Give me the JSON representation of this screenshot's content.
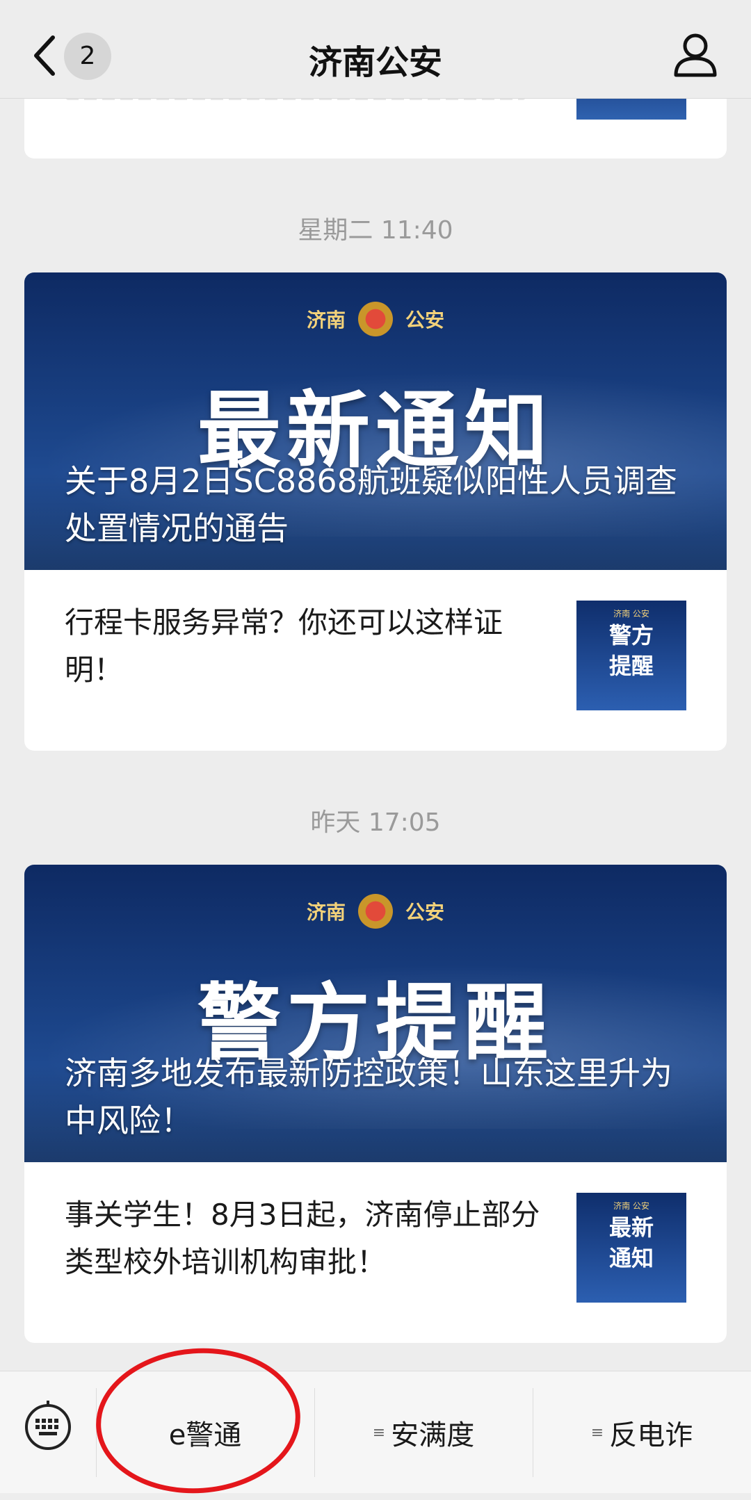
{
  "header": {
    "title": "济南公安",
    "unread_count": "2",
    "back_icon": "chevron-left-icon",
    "profile_icon": "person-icon"
  },
  "feed": {
    "groups": [
      {
        "timestamp": "星期二 11:40",
        "main": {
          "brand_left": "济南",
          "brand_right": "公安",
          "headline": "最新通知",
          "title": "关于8月2日SC8868航班疑似阳性人员调查处置情况的通告"
        },
        "items": [
          {
            "text": "行程卡服务异常？你还可以这样证明！",
            "thumb_brand": "济南 公安",
            "thumb_headline_line1": "警方",
            "thumb_headline_line2": "提醒"
          }
        ]
      },
      {
        "timestamp": "昨天 17:05",
        "main": {
          "brand_left": "济南",
          "brand_right": "公安",
          "headline": "警方提醒",
          "title": "济南多地发布最新防控政策！山东这里升为中风险！"
        },
        "items": [
          {
            "text": "事关学生！8月3日起，济南停止部分类型校外培训机构审批！",
            "thumb_brand": "济南 公安",
            "thumb_headline_line1": "最新",
            "thumb_headline_line2": "通知"
          }
        ]
      }
    ]
  },
  "bottom_bar": {
    "keyboard_icon": "keyboard-icon",
    "menus": [
      {
        "label": "e警通",
        "has_submenu": false
      },
      {
        "label": "安满度",
        "has_submenu": true
      },
      {
        "label": "反电诈",
        "has_submenu": true
      }
    ],
    "submenu_marker": "≡",
    "highlight_color": "#e4161b"
  }
}
